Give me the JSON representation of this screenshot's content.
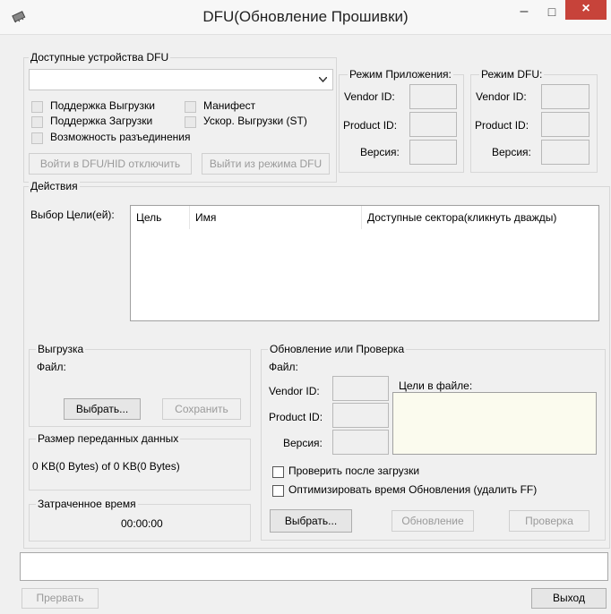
{
  "window": {
    "title": "DFU(Обновление Прошивки)",
    "minimize": "–",
    "maximize": "□",
    "close": "×"
  },
  "devices": {
    "group_label": "Доступные устройства DFU",
    "combo_value": "",
    "checks": {
      "upload_support": "Поддержка Выгрузки",
      "download_support": "Поддержка Загрузки",
      "detach": "Возможность разъединения",
      "manifest": "Манифест",
      "accel_upload": "Ускор. Выгрузки (ST)"
    },
    "enter_dfu_button": "Войти в DFU/HID отключить",
    "leave_dfu_button": "Выйти из режима DFU"
  },
  "app_mode": {
    "label": "Режим Приложения:",
    "vendor": "Vendor ID:",
    "product": "Product ID:",
    "version": "Версия:"
  },
  "dfu_mode": {
    "label": "Режим DFU:",
    "vendor": "Vendor ID:",
    "product": "Product ID:",
    "version": "Версия:"
  },
  "actions": {
    "group_label": "Действия",
    "target_label": "Выбор Цели(ей):",
    "columns": [
      "Цель",
      "Имя",
      "Доступные сектора(кликнуть дважды)"
    ]
  },
  "upload": {
    "label": "Выгрузка",
    "file_label": "Файл:",
    "choose": "Выбрать...",
    "save": "Сохранить"
  },
  "transfer": {
    "label": "Размер переданных данных",
    "value": "0 KB(0 Bytes) of 0 KB(0 Bytes)"
  },
  "elapsed": {
    "label": "Затраченное время",
    "value": "00:00:00"
  },
  "update": {
    "label": "Обновление или Проверка",
    "file_label": "Файл:",
    "vendor": "Vendor ID:",
    "product": "Product ID:",
    "version": "Версия:",
    "targets_label": "Цели в файле:",
    "verify_after": "Проверить после загрузки",
    "optimize": "Оптимизировать время Обновления (удалить FF)",
    "choose": "Выбрать...",
    "update_button": "Обновление",
    "verify_button": "Проверка"
  },
  "footer": {
    "abort": "Прервать",
    "exit": "Выход"
  }
}
